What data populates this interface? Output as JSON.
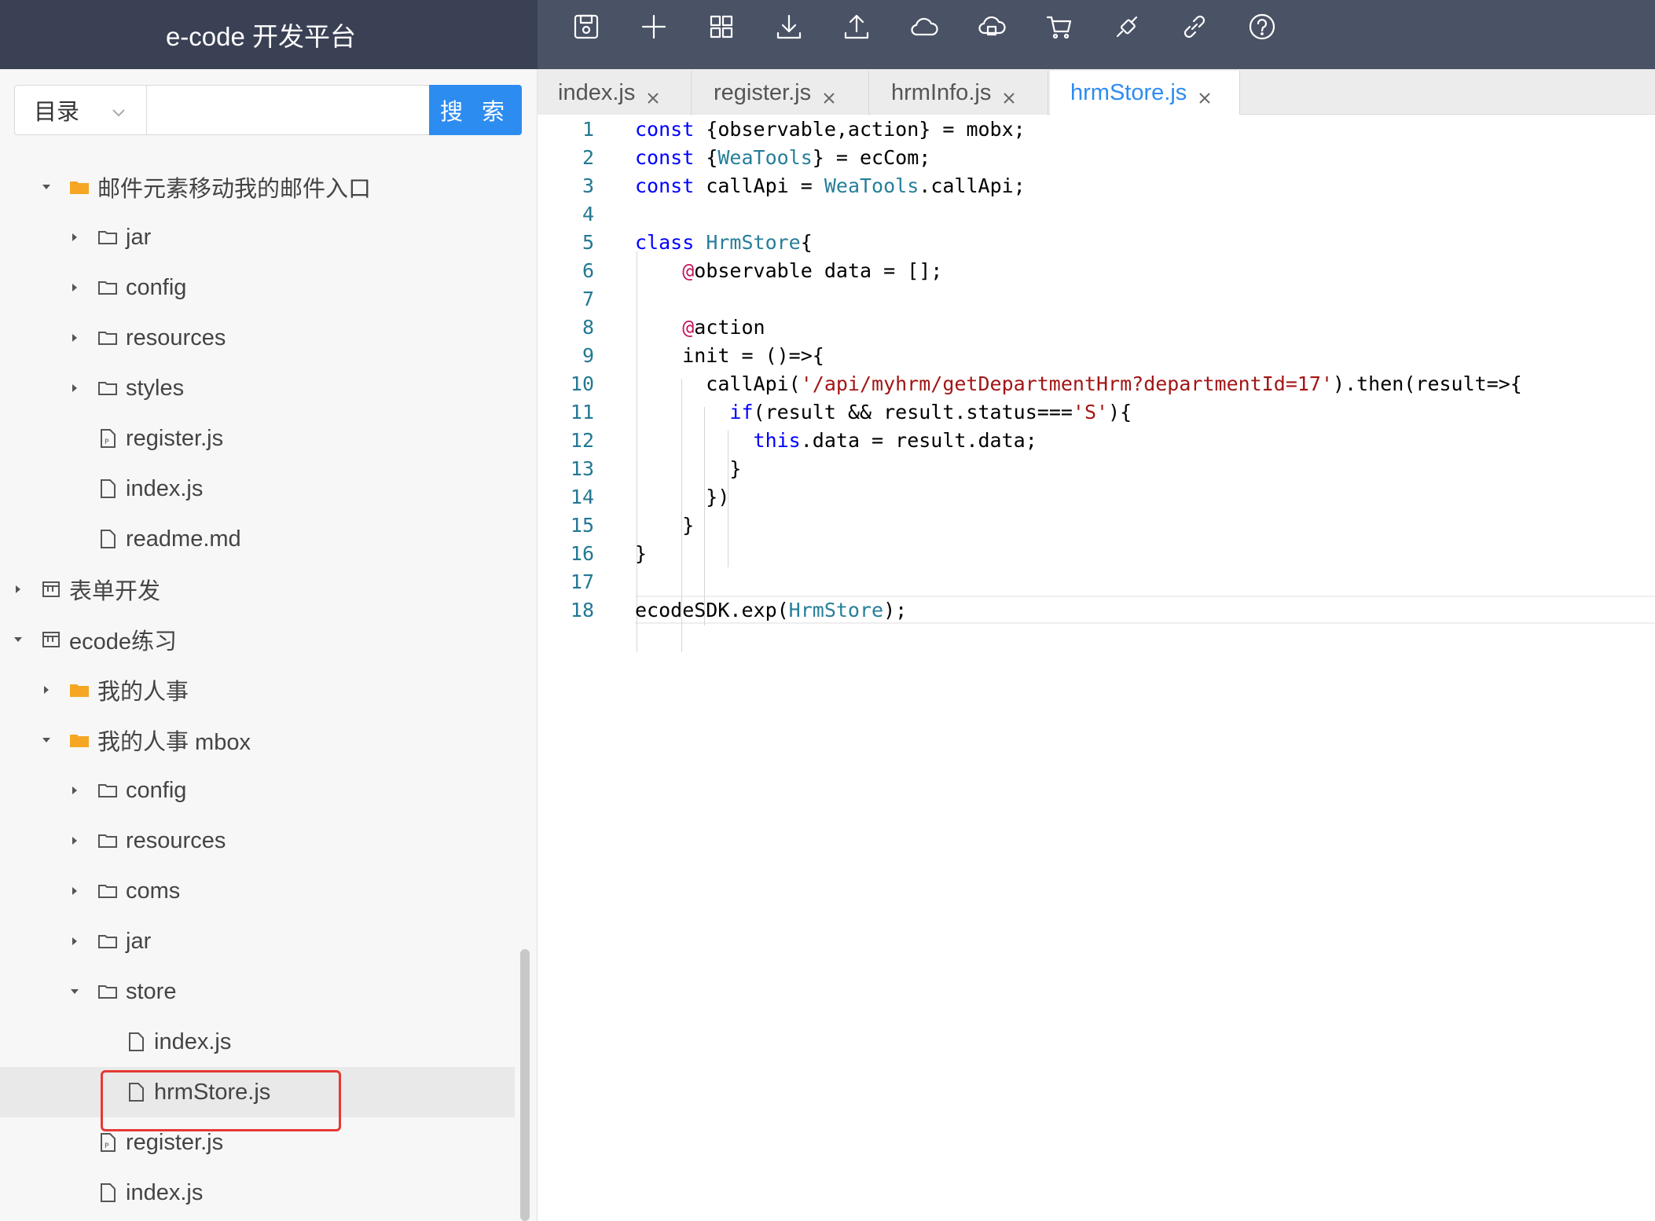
{
  "app": {
    "title": "e-code 开发平台"
  },
  "toolbar": {
    "icons": [
      "save-icon",
      "plus-icon",
      "grid-icon",
      "download-icon",
      "upload-icon",
      "cloud-icon",
      "cloud-sync-icon",
      "cart-icon",
      "plug-icon",
      "link-icon",
      "help-icon"
    ]
  },
  "search": {
    "select_value": "目录",
    "input_value": "",
    "button_label": "搜 索"
  },
  "tree": {
    "n1": "邮件元素移动我的邮件入口",
    "n2": "jar",
    "n3": "config",
    "n4": "resources",
    "n5": "styles",
    "n6": "register.js",
    "n7": "index.js",
    "n8": "readme.md",
    "n9": "表单开发",
    "n10": "ecode练习",
    "n11": "我的人事",
    "n12": "我的人事 mbox",
    "n13": "config",
    "n14": "resources",
    "n15": "coms",
    "n16": "jar",
    "n17": "store",
    "n18": "index.js",
    "n19": "hrmStore.js",
    "n20": "register.js",
    "n21": "index.js"
  },
  "tabs": {
    "t1": "index.js",
    "t2": "register.js",
    "t3": "hrmInfo.js",
    "t4": "hrmStore.js"
  },
  "editor": {
    "line_numbers": [
      "1",
      "2",
      "3",
      "4",
      "5",
      "6",
      "7",
      "8",
      "9",
      "10",
      "11",
      "12",
      "13",
      "14",
      "15",
      "16",
      "17",
      "18"
    ]
  },
  "colors": {
    "header_bg": "#3a4155",
    "toolbar_bg": "#4a5265",
    "accent": "#2d8cf0",
    "highlight": "#e53935"
  }
}
